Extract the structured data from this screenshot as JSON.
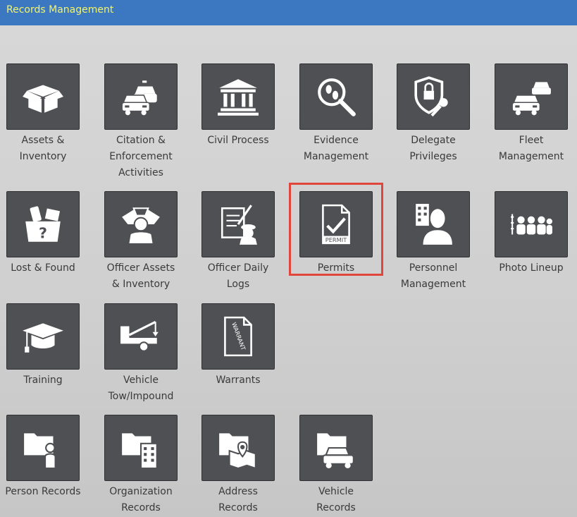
{
  "title": "Records Management",
  "highlight_color": "#e0463c",
  "tiles": [
    {
      "label": "Assets &\nInventory",
      "icon": "open-box-icon"
    },
    {
      "label": "Citation &\nEnforcement\nActivities",
      "icon": "police-car-icon"
    },
    {
      "label": "Civil Process",
      "icon": "courthouse-icon"
    },
    {
      "label": "Evidence\nManagement",
      "icon": "magnifier-footprint-icon"
    },
    {
      "label": "Delegate\nPrivileges",
      "icon": "shield-key-icon"
    },
    {
      "label": "Fleet\nManagement",
      "icon": "fleet-cars-icon"
    },
    {
      "label": "Lost & Found",
      "icon": "lost-found-box-icon"
    },
    {
      "label": "Officer Assets\n& Inventory",
      "icon": "officer-assets-icon"
    },
    {
      "label": "Officer Daily\nLogs",
      "icon": "officer-notebook-icon"
    },
    {
      "label": "Permits",
      "icon": "permit-document-icon",
      "icon_text": "PERMIT"
    },
    {
      "label": "Personnel\nManagement",
      "icon": "personnel-building-icon"
    },
    {
      "label": "Photo Lineup",
      "icon": "lineup-icon"
    },
    {
      "label": "Training",
      "icon": "graduation-cap-icon"
    },
    {
      "label": "Vehicle\nTow/Impound",
      "icon": "tow-truck-icon"
    },
    {
      "label": "Warrants",
      "icon": "warrant-document-icon",
      "icon_text": "WARRANT"
    },
    {
      "label": "Person Records",
      "icon": "person-folder-icon"
    },
    {
      "label": "Organization\nRecords",
      "icon": "organization-folder-icon"
    },
    {
      "label": "Address\nRecords",
      "icon": "address-folder-icon"
    },
    {
      "label": "Vehicle\nRecords",
      "icon": "vehicle-folder-icon"
    }
  ]
}
